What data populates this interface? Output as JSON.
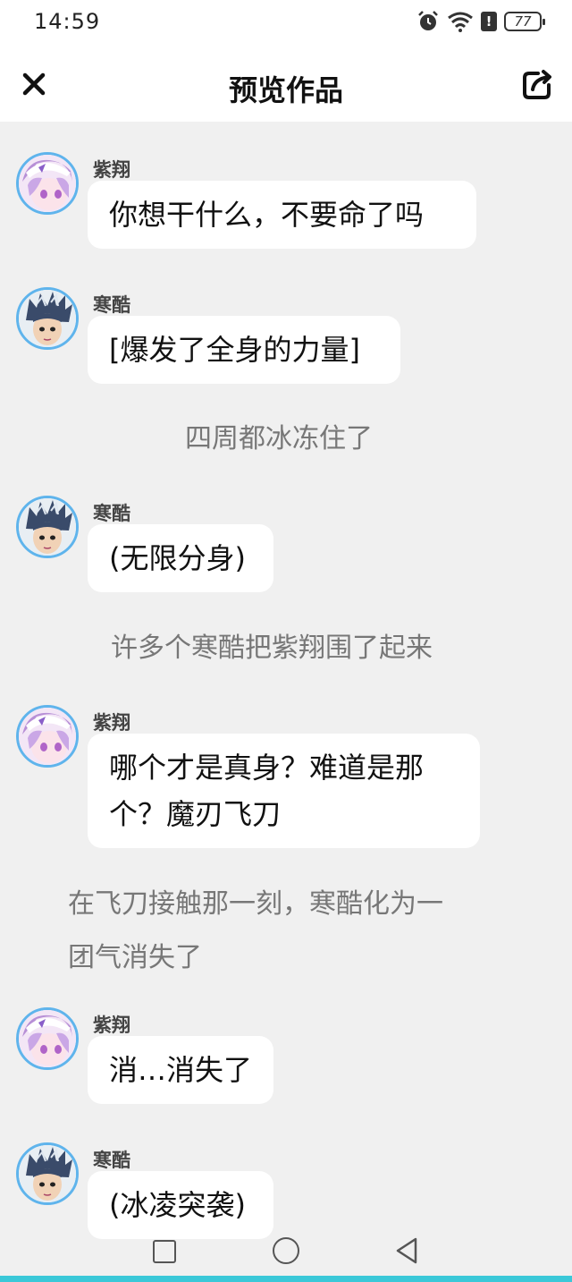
{
  "status_bar": {
    "time": "14:59",
    "battery": "77"
  },
  "header": {
    "title": "预览作品"
  },
  "messages": [
    {
      "sender": "紫翔",
      "text": "你想干什么，不要命了吗"
    },
    {
      "sender": "寒酷",
      "text": "[爆发了全身的力量]"
    },
    {
      "narration": "四周都冰冻住了"
    },
    {
      "sender": "寒酷",
      "text": "(无限分身)"
    },
    {
      "narration": "许多个寒酷把紫翔围了起来"
    },
    {
      "sender": "紫翔",
      "text_line1": "哪个才是真身？难道是那",
      "text_line2": "个？魔刃飞刀"
    },
    {
      "narration_line1": "在飞刀接触那一刻，寒酷化为一",
      "narration_line2": "团气消失了"
    },
    {
      "sender": "紫翔",
      "text": "消…消失了"
    },
    {
      "sender": "寒酷",
      "text": "(冰凌突袭)"
    }
  ],
  "colors": {
    "background": "#f0f0f0",
    "bubble": "#ffffff",
    "avatar_ring": "#5fb4ec",
    "nav_accent": "#3bc8d8"
  }
}
